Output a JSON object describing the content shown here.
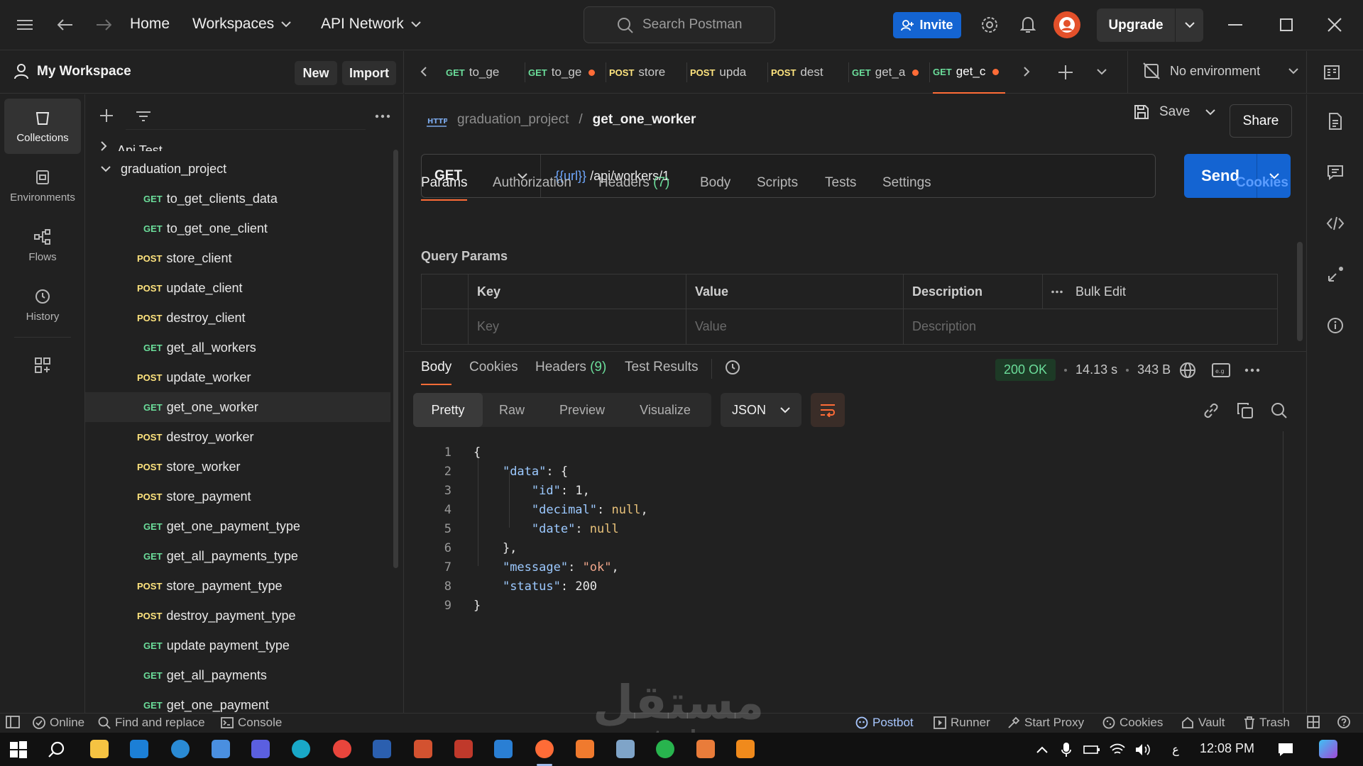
{
  "topbar": {
    "home": "Home",
    "workspaces": "Workspaces",
    "api_network": "API Network",
    "search_placeholder": "Search Postman",
    "invite": "Invite",
    "upgrade": "Upgrade"
  },
  "workspace": {
    "title": "My Workspace",
    "new_label": "New",
    "import_label": "Import"
  },
  "leftnav": [
    {
      "label": "Collections",
      "icon": "collections-icon"
    },
    {
      "label": "Environments",
      "icon": "environments-icon"
    },
    {
      "label": "Flows",
      "icon": "flows-icon"
    },
    {
      "label": "History",
      "icon": "history-icon"
    }
  ],
  "tree": {
    "partial_item": "Api Test",
    "collection": "graduation_project",
    "items": [
      {
        "method": "GET",
        "name": "to_get_clients_data"
      },
      {
        "method": "GET",
        "name": "to_get_one_client"
      },
      {
        "method": "POST",
        "name": "store_client"
      },
      {
        "method": "POST",
        "name": "update_client"
      },
      {
        "method": "POST",
        "name": "destroy_client"
      },
      {
        "method": "GET",
        "name": "get_all_workers"
      },
      {
        "method": "POST",
        "name": "update_worker"
      },
      {
        "method": "GET",
        "name": "get_one_worker"
      },
      {
        "method": "POST",
        "name": "destroy_worker"
      },
      {
        "method": "POST",
        "name": "store_worker"
      },
      {
        "method": "POST",
        "name": "store_payment"
      },
      {
        "method": "GET",
        "name": "get_one_payment_type"
      },
      {
        "method": "GET",
        "name": "get_all_payments_type"
      },
      {
        "method": "POST",
        "name": "store_payment_type"
      },
      {
        "method": "POST",
        "name": "destroy_payment_type"
      },
      {
        "method": "GET",
        "name": "update payment_type"
      },
      {
        "method": "GET",
        "name": "get_all_payments"
      },
      {
        "method": "GET",
        "name": "get_one_payment"
      }
    ]
  },
  "tabs": [
    {
      "method": "GET",
      "name": "to_ge",
      "dirty": false
    },
    {
      "method": "GET",
      "name": "to_ge",
      "dirty": true
    },
    {
      "method": "POST",
      "name": "store",
      "dirty": false
    },
    {
      "method": "POST",
      "name": "upda",
      "dirty": false
    },
    {
      "method": "POST",
      "name": "dest",
      "dirty": false
    },
    {
      "method": "GET",
      "name": "get_a",
      "dirty": true
    },
    {
      "method": "GET",
      "name": "get_c",
      "dirty": true
    }
  ],
  "environment": "No environment",
  "request": {
    "breadcrumb_collection": "graduation_project",
    "breadcrumb_request": "get_one_worker",
    "save": "Save",
    "share": "Share",
    "method": "GET",
    "url_var": "{{url}}",
    "url_path": " /api/workers/1",
    "send": "Send",
    "tabs": {
      "params": "Params",
      "authorization": "Authorization",
      "headers": "Headers",
      "headers_count": "(7)",
      "body": "Body",
      "scripts": "Scripts",
      "tests": "Tests",
      "settings": "Settings",
      "cookies": "Cookies"
    },
    "query_params_label": "Query Params",
    "table": {
      "key": "Key",
      "value": "Value",
      "description": "Description",
      "bulk_edit": "Bulk Edit",
      "key_ph": "Key",
      "value_ph": "Value",
      "description_ph": "Description"
    }
  },
  "response": {
    "tabs": {
      "body": "Body",
      "cookies": "Cookies",
      "headers": "Headers",
      "headers_count": "(9)",
      "test_results": "Test Results"
    },
    "status": "200 OK",
    "time": "14.13 s",
    "size": "343 B",
    "views": [
      "Pretty",
      "Raw",
      "Preview",
      "Visualize"
    ],
    "format": "JSON",
    "lines": [
      "1",
      "2",
      "3",
      "4",
      "5",
      "6",
      "7",
      "8",
      "9"
    ],
    "json": {
      "key_data": "\"data\"",
      "key_id": "\"id\"",
      "val_id": "1",
      "key_decimal": "\"decimal\"",
      "key_date": "\"date\"",
      "null": "null",
      "key_message": "\"message\"",
      "val_message": "\"ok\"",
      "key_status": "\"status\"",
      "val_status": "200"
    }
  },
  "statusbar": {
    "online": "Online",
    "find_replace": "Find and replace",
    "console": "Console",
    "postbot": "Postbot",
    "runner": "Runner",
    "start_proxy": "Start Proxy",
    "cookies": "Cookies",
    "vault": "Vault",
    "trash": "Trash"
  },
  "taskbar": {
    "clock": "12:08 PM",
    "lang": "ع"
  },
  "watermark": {
    "arabic": "مستقل",
    "latin": "mostaql.com"
  },
  "colors": {
    "accent": "#ff6c37",
    "primary_button": "#1464d2",
    "get": "#6bdd9a",
    "post": "#ffe47e"
  }
}
